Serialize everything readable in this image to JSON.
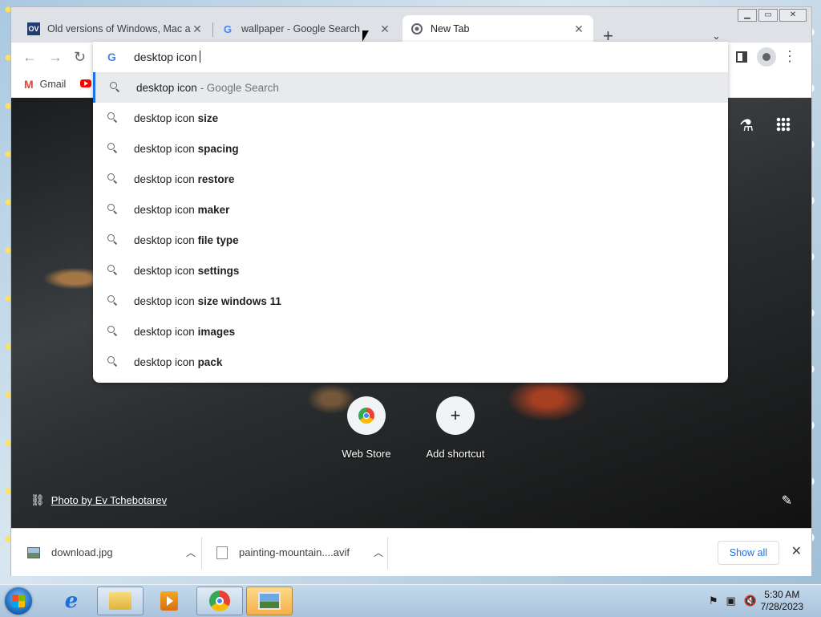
{
  "tabs": [
    {
      "title": "Old versions of Windows, Mac and",
      "favicon_text": "OV",
      "favicon": "ov-favicon"
    },
    {
      "title": "wallpaper - Google Search",
      "favicon_text": "G",
      "favicon": "google-favicon"
    },
    {
      "title": "New Tab",
      "favicon": "chrome-favicon"
    }
  ],
  "bookmarks": [
    {
      "label": "Gmail",
      "icon": "gmail-icon"
    },
    {
      "label": "",
      "icon": "youtube-icon"
    }
  ],
  "omnibox": {
    "value": "desktop icon",
    "suggestions": [
      {
        "base": "desktop icon",
        "bold": "",
        "suffix": " - Google Search"
      },
      {
        "base": "desktop icon ",
        "bold": "size",
        "suffix": ""
      },
      {
        "base": "desktop icon ",
        "bold": "spacing",
        "suffix": ""
      },
      {
        "base": "desktop icon ",
        "bold": "restore",
        "suffix": ""
      },
      {
        "base": "desktop icon ",
        "bold": "maker",
        "suffix": ""
      },
      {
        "base": "desktop icon ",
        "bold": "file type",
        "suffix": ""
      },
      {
        "base": "desktop icon ",
        "bold": "settings",
        "suffix": ""
      },
      {
        "base": "desktop icon ",
        "bold": "size windows 11",
        "suffix": ""
      },
      {
        "base": "desktop icon ",
        "bold": "images",
        "suffix": ""
      },
      {
        "base": "desktop icon ",
        "bold": "pack",
        "suffix": ""
      }
    ]
  },
  "ntp": {
    "shortcuts": [
      {
        "label": "Web Store",
        "icon": "webstore-icon"
      },
      {
        "label": "Add shortcut",
        "icon": "plus-icon"
      }
    ],
    "photo_credit": "Photo by Ev Tchebotarev"
  },
  "downloads": {
    "items": [
      {
        "name": "download.jpg",
        "icon": "image-file-icon"
      },
      {
        "name": "painting-mountain....avif",
        "icon": "file-icon"
      }
    ],
    "show_all_label": "Show all"
  },
  "taskbar": {
    "clock_time": "5:30 AM",
    "clock_date": "7/28/2023"
  },
  "colors": {
    "accent": "#1a73e8",
    "tab_strip": "#dee1e6"
  }
}
